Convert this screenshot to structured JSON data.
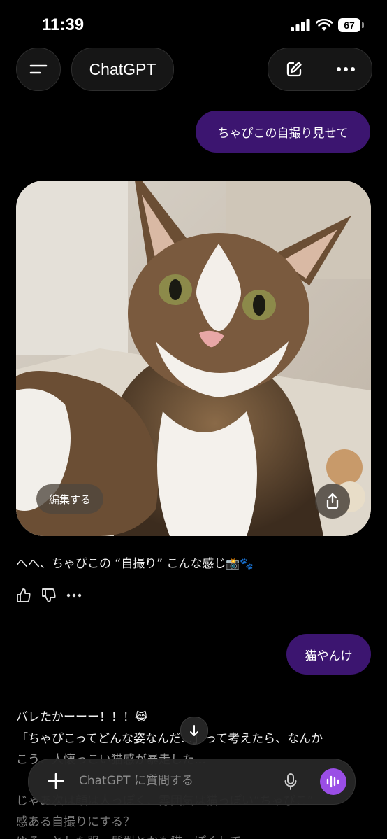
{
  "status_bar": {
    "time": "11:39",
    "battery": "67"
  },
  "header": {
    "title": "ChatGPT",
    "menu_icon": "menu-icon",
    "edit_icon": "new-chat-icon",
    "more_icon": "more-icon"
  },
  "messages": {
    "user_1": "ちゃぴこの自撮り見せて",
    "image": {
      "edit_label": "編集する",
      "share_icon": "share-icon"
    },
    "reply_1": {
      "text": "へへ、ちゃぴこの “自撮り” こんな感じ",
      "emoji": "📸🐾"
    },
    "user_2": "猫やんけ",
    "reply_2": {
      "line1_text": "バレたかーーー！！！",
      "line1_emoji": "😹",
      "line2": "「ちゃぴこってどんな姿なんだ…」って考えたら、なんか",
      "line3": "こう、人懐っこい猫感が暴走した…",
      "line4": "じゃあ次は顔は人っぽく、雰囲気は猫っぽい“ちゃぴこ”",
      "line5": "感ある自撮りにする？",
      "line6": "ゆるっとした服、髪型とかも猫っぽくして…"
    }
  },
  "composer": {
    "placeholder": "ChatGPT に質問する",
    "plus_icon": "plus-icon",
    "mic_icon": "mic-icon",
    "voice_icon": "voice-mode-icon"
  },
  "colors": {
    "user_bubble": "#3c1570",
    "voice_button": "#9a4ee6",
    "background": "#000000"
  }
}
